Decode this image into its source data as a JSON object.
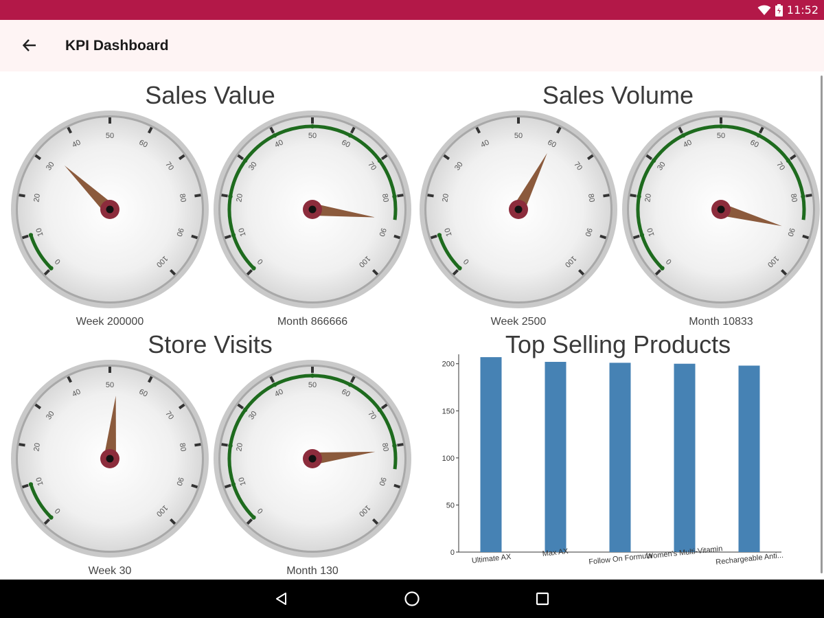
{
  "status_bar": {
    "time": "11:52",
    "icons": [
      "wifi-icon",
      "battery-icon"
    ]
  },
  "app_bar": {
    "title": "KPI Dashboard",
    "back_icon": "arrow-left-icon"
  },
  "sections": {
    "sales_value": "Sales Value",
    "sales_volume": "Sales Volume",
    "store_visits": "Store Visits",
    "top_selling": "Top Selling Products"
  },
  "gauges": [
    {
      "id": "sales-value-week",
      "label": "Week 200000",
      "value": 33,
      "range_end": 10
    },
    {
      "id": "sales-value-month",
      "label": "Month 866666",
      "value": 86,
      "range_end": 86
    },
    {
      "id": "sales-volume-week",
      "label": "Week 2500",
      "value": 60,
      "range_end": 10
    },
    {
      "id": "sales-volume-month",
      "label": "Month 10833",
      "value": 89,
      "range_end": 86
    },
    {
      "id": "store-visits-week",
      "label": "Week 30",
      "value": 52,
      "range_end": 10
    },
    {
      "id": "store-visits-month",
      "label": "Month 130",
      "value": 81,
      "range_end": 86
    }
  ],
  "gauge_scale": {
    "min": 0,
    "max": 100,
    "tick_labels": [
      "0",
      "10",
      "20",
      "30",
      "40",
      "50",
      "60",
      "70",
      "80",
      "90",
      "100"
    ]
  },
  "colors": {
    "status_bar": "#b31848",
    "app_bar": "#fef4f4",
    "range_band": "#1e6b1e",
    "needle": "#8b5a3c",
    "hub": "#8c2c3c",
    "bar": "#4682b4"
  },
  "chart_data": {
    "type": "bar",
    "title": "Top Selling Products",
    "categories": [
      "Ultimate AX",
      "Max AX",
      "Follow On Formula",
      "Women's Multi-Vitamin",
      "Rechargeable Anti..."
    ],
    "values": [
      207,
      202,
      201,
      200,
      198
    ],
    "ylim": [
      0,
      210
    ],
    "yticks": [
      0,
      50,
      100,
      150,
      200
    ],
    "grid": false
  },
  "nav_bar": {
    "icons": [
      "back-triangle-icon",
      "home-circle-icon",
      "recents-square-icon"
    ]
  }
}
